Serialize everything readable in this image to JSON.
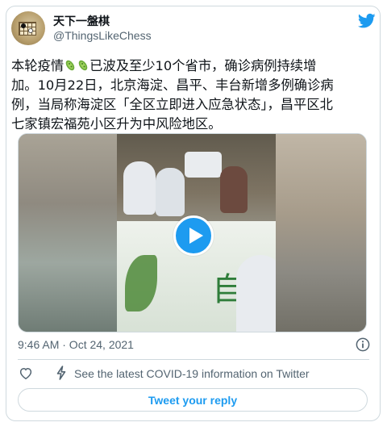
{
  "user": {
    "display_name": "天下一盤棋",
    "handle": "@ThingsLikeChess"
  },
  "tweet": {
    "lines": [
      "本轮疫情🦠🦠已波及至少10个省市，确诊病例持续增",
      "加。10月22日，北京海淀、昌平、丰台新增多例确诊病",
      "例，当局称海淀区「全区立即进入应急状态」，昌平区北",
      "七家镇宏福苑小区升为中风险地区。"
    ],
    "line1_before": "本轮疫情",
    "line1_after": "已波及至少10个省市，确诊病例持续增",
    "line2": "加。10月22日，北京海淀、昌平、丰台新增多例确诊病",
    "line3": "例，当局称海淀区「全区立即进入应急状态」，昌平区北",
    "line4": "七家镇宏福苑小区升为中风险地区。",
    "emoji": [
      "microbe-icon",
      "microbe-icon"
    ]
  },
  "media": {
    "type": "video",
    "sign_text": "自"
  },
  "meta": {
    "timestamp": "9:46 AM · Oct 24, 2021"
  },
  "actions": {
    "covid_info": "See the latest COVID-19 information on Twitter",
    "reply_label": "Tweet your reply"
  },
  "colors": {
    "accent": "#1d9bf0",
    "secondary_text": "#536471",
    "border": "#cfd9de"
  },
  "icons": [
    "twitter-logo-icon",
    "play-icon",
    "info-icon",
    "heart-icon",
    "bolt-icon"
  ]
}
